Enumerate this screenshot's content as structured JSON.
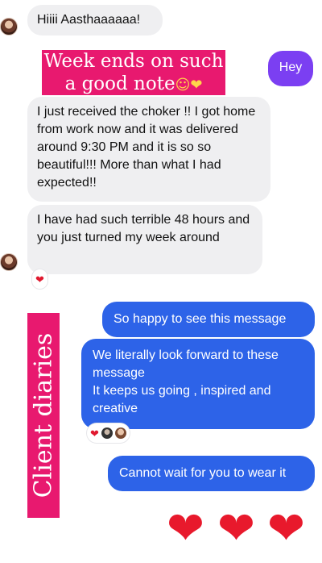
{
  "messages": {
    "m1": "Hiiii Aasthaaaaaa!",
    "banner_top": "Week ends on such a good note",
    "banner_emojis": "☺❤",
    "m_hey": "Hey",
    "m2": "I just received the choker !! I got home from work now and it was delivered around 9:30 PM and it is so so beautiful!!! More than what I had expected!!",
    "m3": "I have had such terrible 48 hours and you just turned my week around",
    "m4": "So happy to see this message",
    "m5_line1": "We literally look forward to these message",
    "m5_line2": "It keeps us going , inspired and creative",
    "m6": "Cannot wait for you to wear it"
  },
  "side_banner": "Client diaries",
  "reactions": {
    "m3_heart": "❤",
    "m5_heart": "❤"
  },
  "hearts": [
    "❤",
    "❤",
    "❤"
  ],
  "colors": {
    "received_bubble": "#efeff1",
    "sent_bubble": "#2d63e8",
    "hey_bubble": "#7b3ff2",
    "banner": "#e8196f",
    "heart": "#e8192c"
  }
}
